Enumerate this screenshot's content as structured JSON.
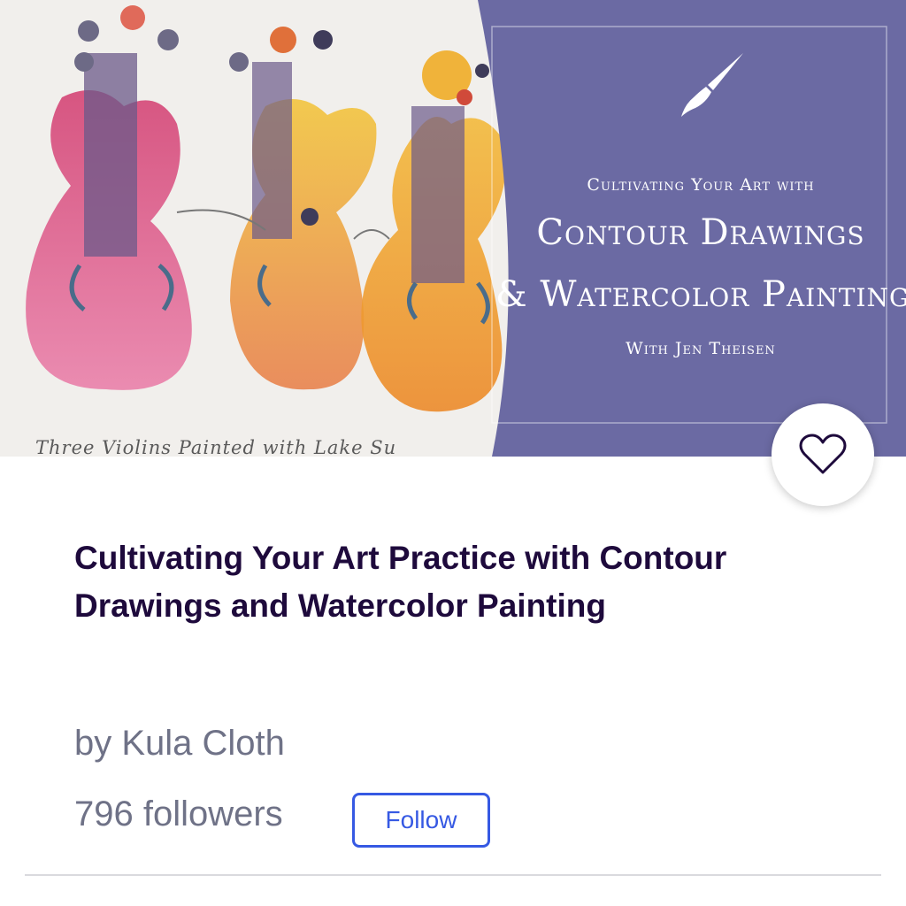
{
  "hero": {
    "painting_caption": "Three Violins Painted with Lake Su",
    "banner": {
      "eyebrow": "Cultivating Your Art with",
      "title_line_1": "Contour Drawings",
      "title_line_2": "& Watercolor Painting",
      "author": "With Jen Theisen",
      "background_color": "#6b6aa3",
      "icon": "paintbrush-icon"
    }
  },
  "save": {
    "icon": "heart-outline-icon"
  },
  "event": {
    "title": "Cultivating Your Art Practice with Contour Drawings and Watercolor Painting"
  },
  "organizer": {
    "byline": "by Kula Cloth",
    "followers": "796 followers",
    "follow_label": "Follow"
  },
  "colors": {
    "title": "#1e0a3c",
    "muted_text": "#6f7287",
    "accent": "#3659e3"
  }
}
